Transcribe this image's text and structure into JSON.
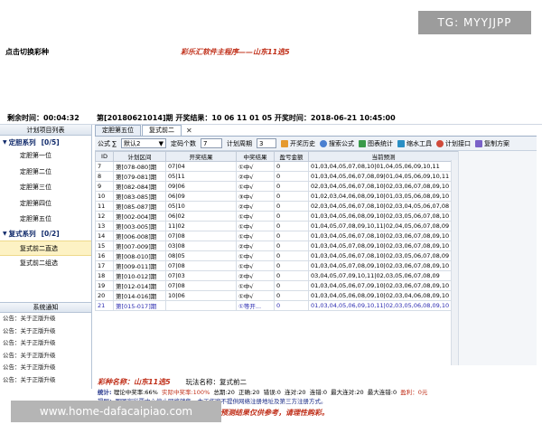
{
  "watermarks": {
    "tg": "TG: MYYJJPP",
    "url": "www.home-dafacaipiao.com"
  },
  "top": {
    "switch_label": "点击切换彩种",
    "banner": "彩乐汇软件主程序——山东11选5"
  },
  "info": {
    "remain_label": "剩余时间：00:04:32",
    "issue_text": "第[20180621014]期  开奖结果：10 06 11 01 05  开奖时间：2018-06-21 10:45:00"
  },
  "sidebar": {
    "header": "计划项目列表",
    "groups": [
      {
        "label": "定胆系列",
        "count": "[0/5]",
        "items": [
          "定胆第一位",
          "定胆第二位",
          "定胆第三位",
          "定胆第四位",
          "定胆第五位"
        ]
      },
      {
        "label": "复式系列",
        "count": "[0/2]",
        "items": [
          "复式前二直选",
          "复式前二组选"
        ]
      }
    ],
    "selected": "复式前二直选",
    "notice_header": "系统通知",
    "notices": [
      "公告：关于正版升级",
      "公告：关于正版升级",
      "公告：关于正版升级",
      "公告：关于正版升级",
      "公告：关于正版升级",
      "公告：关于正版升级"
    ]
  },
  "tabs": [
    "定胆第五位",
    "复式前二"
  ],
  "toolbar": {
    "formula_label": "公式 ∑",
    "formula_value": "默认2",
    "count_label": "定码个数",
    "count_value": "7",
    "cycle_label": "计划周期",
    "cycle_value": "3",
    "buttons": [
      "开奖历史",
      "搜索公式",
      "图表统计",
      "缩水工具",
      "计划接口",
      "复制方案"
    ]
  },
  "table": {
    "columns": [
      "ID",
      "计划区间",
      "开奖结果",
      "中奖结果",
      "盈亏金额",
      "当前预测"
    ],
    "rows": [
      [
        "7",
        "第[078-080]期",
        "07|04",
        "①中√",
        "0",
        "01,03,04,05,07,08,10|01,04,05,06,09,10,11"
      ],
      [
        "8",
        "第[079-081]期",
        "05|11",
        "②中√",
        "0",
        "01,03,04,05,06,07,08,09|01,04,05,06,09,10,11"
      ],
      [
        "9",
        "第[082-084]期",
        "09|06",
        "①中√",
        "0",
        "02,03,04,05,06,07,08,10|02,03,06,07,08,09,10"
      ],
      [
        "10",
        "第[083-085]期",
        "06|09",
        "③中√",
        "0",
        "01,02,03,04,06,08,09,10|01,03,05,06,08,09,10"
      ],
      [
        "11",
        "第[085-087]期",
        "05|10",
        "②中√",
        "0",
        "02,03,04,05,06,07,08,10|02,03,04,05,06,07,08"
      ],
      [
        "12",
        "第[002-004]期",
        "06|02",
        "①中√",
        "0",
        "01,03,04,05,06,08,09,10|02,03,05,06,07,08,10"
      ],
      [
        "13",
        "第[003-005]期",
        "11|02",
        "①中√",
        "0",
        "01,04,05,07,08,09,10,11|02,04,05,06,07,08,09"
      ],
      [
        "14",
        "第[006-008]期",
        "07|08",
        "①中√",
        "0",
        "01,03,04,05,06,07,08,10|02,03,06,07,08,09,10"
      ],
      [
        "15",
        "第[007-009]期",
        "03|08",
        "②中√",
        "0",
        "01,03,04,05,07,08,09,10|02,03,06,07,08,09,10"
      ],
      [
        "16",
        "第[008-010]期",
        "08|05",
        "①中√",
        "0",
        "01,03,04,05,06,07,08,10|02,03,05,06,07,08,09"
      ],
      [
        "17",
        "第[009-011]期",
        "07|08",
        "①中√",
        "0",
        "01,03,04,05,07,08,09,10|02,03,06,07,08,09,10"
      ],
      [
        "18",
        "第[010-012]期",
        "07|03",
        "②中√",
        "0",
        "03,04,05,07,09,10,11|02,03,05,06,07,08,09"
      ],
      [
        "19",
        "第[012-014]期",
        "07|08",
        "①中√",
        "0",
        "01,03,04,05,06,07,09,10|02,03,06,07,08,09,10"
      ],
      [
        "20",
        "第[014-016]期",
        "10|06",
        "①中√",
        "0",
        "01,03,04,05,06,08,09,10|02,03,04,06,08,09,10"
      ],
      [
        "21",
        "第[015-017]期",
        "",
        "①等开...",
        "0",
        "01,03,04,05,06,09,10,11|02,03,05,06,08,09,10"
      ]
    ]
  },
  "bottom": {
    "lottery": "彩种名称：山东11选5",
    "play_label": "玩法名称：复式前二",
    "stats": {
      "label": "统计:",
      "theory": "理论中奖率:66%",
      "actual": "实际中奖率:100%",
      "total": "总期:20",
      "correct": "正确:20",
      "wrong": "错误:0",
      "streak_hit": "连对:20",
      "streak_miss": "连错:0",
      "max_hit": "最大连对:20",
      "max_miss": "最大连错:0",
      "profit": "盈利：0元"
    },
    "reminder": "提醒：因国家彩票中心停止网络销售，本工作室不提供网络注册地址及第三方注册方式。",
    "warning": "友情提示：购彩有风险，投注需谨慎，预测结果仅供参考，请理性购彩。"
  },
  "colors": {
    "accent_red": "#c0301a",
    "link_blue": "#1e2f88",
    "selected_bg": "#fdf2c4"
  }
}
